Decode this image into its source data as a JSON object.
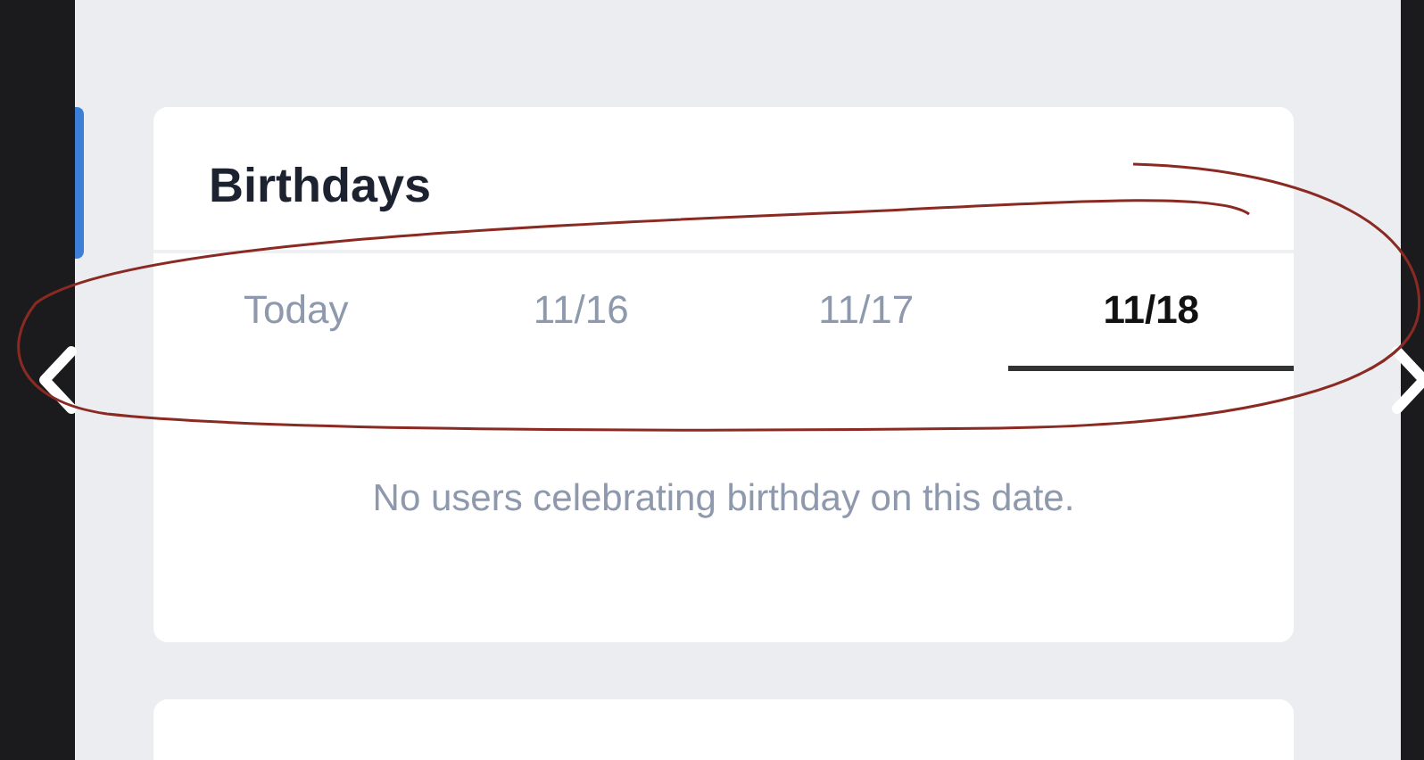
{
  "card": {
    "title": "Birthdays",
    "tabs": [
      {
        "label": "Today",
        "selected": false
      },
      {
        "label": "11/16",
        "selected": false
      },
      {
        "label": "11/17",
        "selected": false
      },
      {
        "label": "11/18",
        "selected": true
      }
    ],
    "empty_message": "No users celebrating birthday on this date."
  }
}
